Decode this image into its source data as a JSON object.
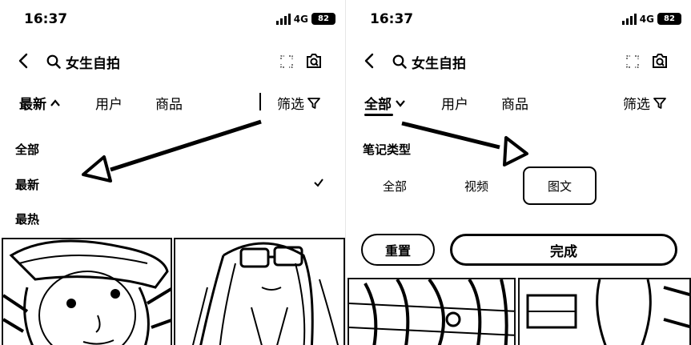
{
  "left": {
    "status": {
      "time": "16:37",
      "network": "4G",
      "battery": "82"
    },
    "search": {
      "query": "女生自拍"
    },
    "tabs": [
      {
        "label": "最新",
        "active": true
      },
      {
        "label": "用户"
      },
      {
        "label": "商品"
      }
    ],
    "filter_label": "筛选",
    "dropdown": [
      {
        "label": "全部"
      },
      {
        "label": "最新",
        "checked": true
      },
      {
        "label": "最热"
      }
    ]
  },
  "right": {
    "status": {
      "time": "16:37",
      "network": "4G",
      "battery": "82"
    },
    "search": {
      "query": "女生自拍"
    },
    "tabs": [
      {
        "label": "全部",
        "active": true
      },
      {
        "label": "用户"
      },
      {
        "label": "商品"
      }
    ],
    "filter_label": "筛选",
    "filter_panel": {
      "section_title": "笔记类型",
      "options": [
        {
          "label": "全部"
        },
        {
          "label": "视频"
        },
        {
          "label": "图文",
          "selected": true
        }
      ],
      "reset_label": "重置",
      "done_label": "完成"
    }
  },
  "icons": {
    "back": "chevron-left-icon",
    "search": "search-icon",
    "scan": "scan-icon",
    "camera": "camera-search-icon",
    "filter": "funnel-icon",
    "expand_up": "chevron-up-icon",
    "expand_down": "chevron-down-icon",
    "check": "check-icon"
  }
}
